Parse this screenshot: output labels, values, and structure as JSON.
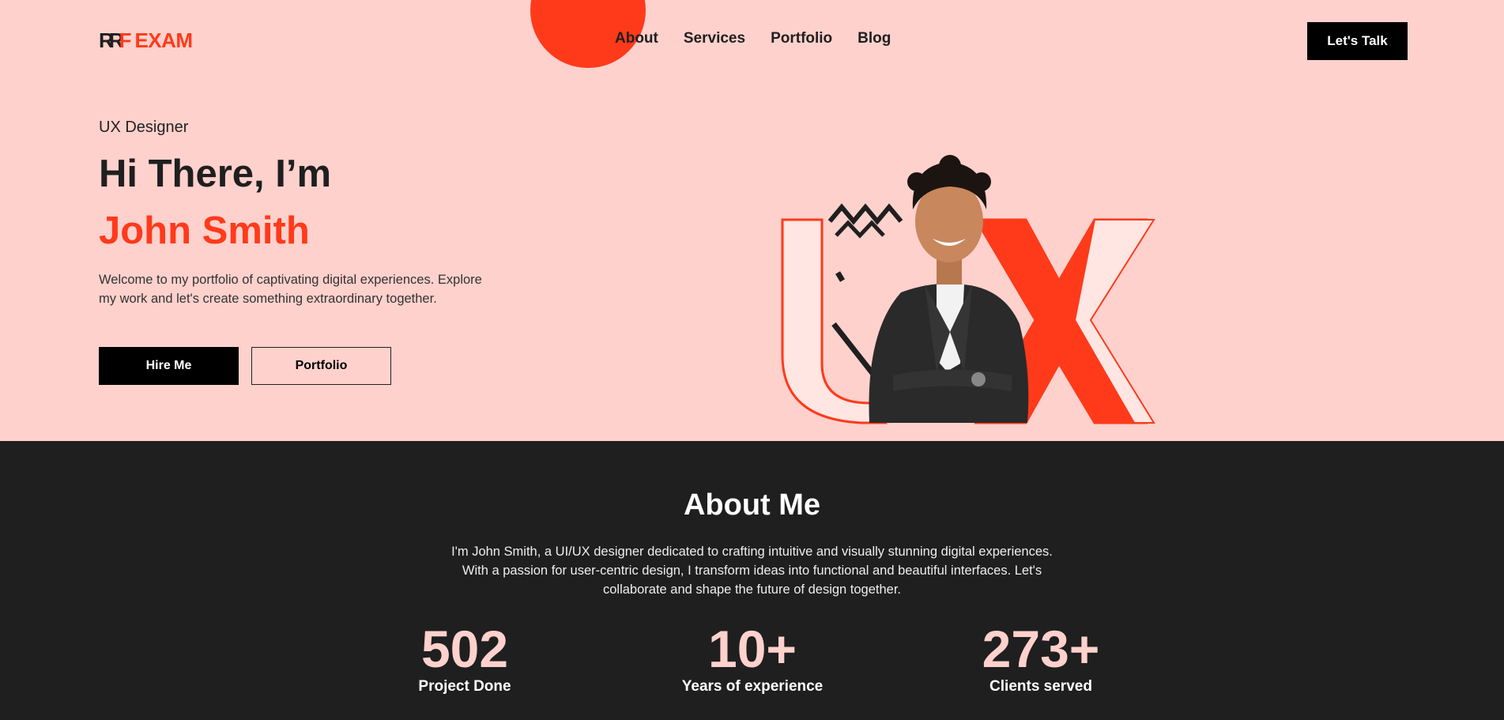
{
  "header": {
    "logo_mark": "RR",
    "logo_mark_accent": "F",
    "logo_text": "EXAM",
    "nav": [
      "About",
      "Services",
      "Portfolio",
      "Blog"
    ],
    "cta_label": "Let's Talk"
  },
  "hero": {
    "role": "UX Designer",
    "greeting": "Hi There, I’m",
    "name": "John Smith",
    "intro": "Welcome to my portfolio of captivating digital experiences. Explore my work and let's create something extraordinary together.",
    "hire_label": "Hire Me",
    "portfolio_label": "Portfolio",
    "art_letters": "UX"
  },
  "about": {
    "title": "About Me",
    "text": "I'm John Smith, a UI/UX designer dedicated to crafting intuitive and visually stunning digital experiences. With a passion for user-centric design, I transform ideas into functional and beautiful interfaces. Let's collaborate and shape the future of design together.",
    "stats": [
      {
        "value": "502",
        "label": "Project Done"
      },
      {
        "value": "10+",
        "label": "Years of experience"
      },
      {
        "value": "273+",
        "label": "Clients served"
      }
    ]
  },
  "colors": {
    "accent": "#ff3a1a",
    "hero_bg": "#ffd1cd",
    "dark_bg": "#1f1f1f"
  },
  "icons": [
    "logo-icon",
    "portrait-illustration",
    "ux-letters-illustration"
  ]
}
